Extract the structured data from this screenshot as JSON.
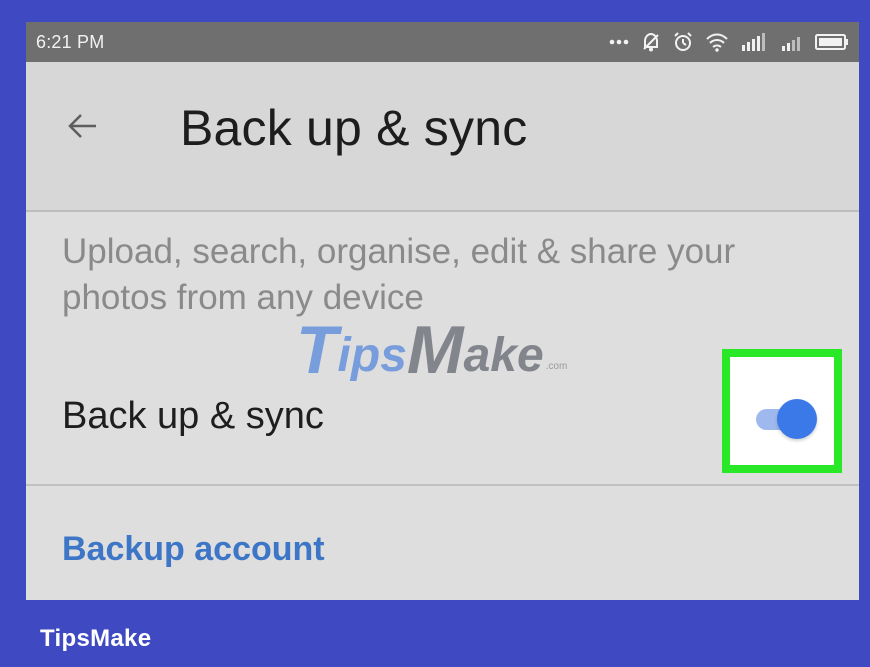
{
  "status_bar": {
    "time": "6:21 PM",
    "icons": [
      "more-dots-icon",
      "notifications-off-icon",
      "alarm-icon",
      "wifi-icon",
      "signal-icon",
      "signal-secondary-icon",
      "battery-icon"
    ]
  },
  "app_bar": {
    "back_icon": "arrow-back-icon",
    "title": "Back up & sync"
  },
  "content": {
    "description": "Upload, search, organise, edit & share your photos from any device",
    "setting_label": "Back up & sync",
    "toggle_enabled": true,
    "backup_account_label": "Backup account"
  },
  "watermark": {
    "text": "TipsMake",
    "parts": [
      "T",
      "ips",
      "M",
      "ake",
      ".com"
    ]
  },
  "footer": {
    "brand": "TipsMake"
  },
  "colors": {
    "frame_background": "#3f4ac2",
    "status_bar": "#6f6f6f",
    "screen_background": "#dedede",
    "accent_blue": "#3b79e8",
    "highlight_green": "#28e828",
    "link_blue": "#3e76c7"
  }
}
